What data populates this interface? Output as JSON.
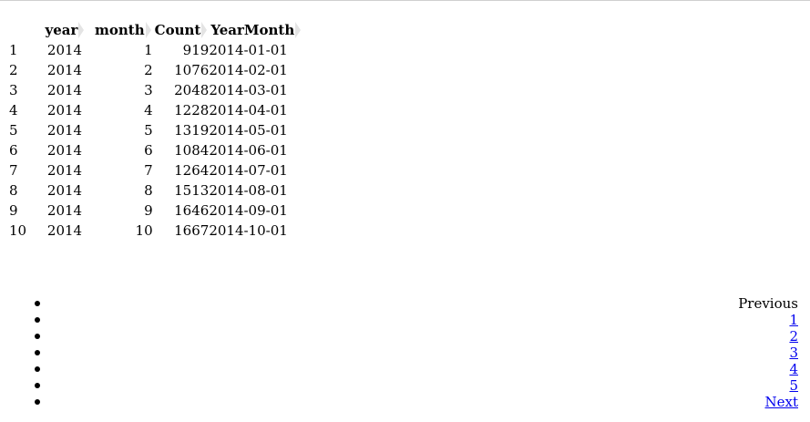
{
  "table": {
    "columns": [
      "year",
      "month",
      "Count",
      "YearMonth"
    ],
    "rows": [
      {
        "idx": "1",
        "year": "2014",
        "month": "1",
        "count": "919",
        "ym": "2014-01-01"
      },
      {
        "idx": "2",
        "year": "2014",
        "month": "2",
        "count": "1076",
        "ym": "2014-02-01"
      },
      {
        "idx": "3",
        "year": "2014",
        "month": "3",
        "count": "2048",
        "ym": "2014-03-01"
      },
      {
        "idx": "4",
        "year": "2014",
        "month": "4",
        "count": "1228",
        "ym": "2014-04-01"
      },
      {
        "idx": "5",
        "year": "2014",
        "month": "5",
        "count": "1319",
        "ym": "2014-05-01"
      },
      {
        "idx": "6",
        "year": "2014",
        "month": "6",
        "count": "1084",
        "ym": "2014-06-01"
      },
      {
        "idx": "7",
        "year": "2014",
        "month": "7",
        "count": "1264",
        "ym": "2014-07-01"
      },
      {
        "idx": "8",
        "year": "2014",
        "month": "8",
        "count": "1513",
        "ym": "2014-08-01"
      },
      {
        "idx": "9",
        "year": "2014",
        "month": "9",
        "count": "1646",
        "ym": "2014-09-01"
      },
      {
        "idx": "10",
        "year": "2014",
        "month": "10",
        "count": "1667",
        "ym": "2014-10-01"
      }
    ]
  },
  "pagination": {
    "previous": "Previous",
    "pages": [
      "1",
      "2",
      "3",
      "4",
      "5"
    ],
    "next": "Next"
  }
}
